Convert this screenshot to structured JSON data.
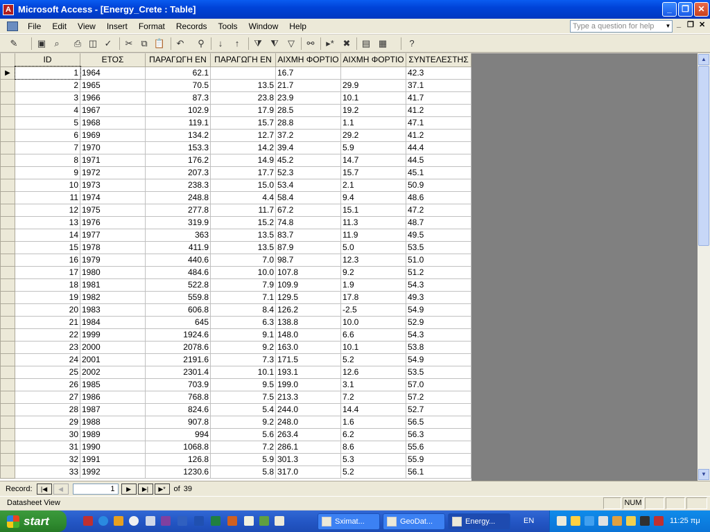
{
  "window": {
    "title": "Microsoft Access - [Energy_Crete : Table]",
    "buttons": {
      "minimize": "_",
      "restore": "❐",
      "close": "✕"
    }
  },
  "menu": {
    "items": [
      "File",
      "Edit",
      "View",
      "Insert",
      "Format",
      "Records",
      "Tools",
      "Window",
      "Help"
    ],
    "ask_placeholder": "Type a question for help"
  },
  "toolbar": {
    "icons": [
      "design-view-icon",
      "save-icon",
      "search-file-icon",
      "print-icon",
      "print-preview-icon",
      "spelling-icon",
      "cut-icon",
      "copy-icon",
      "paste-icon",
      "undo-icon",
      "hyperlink-icon",
      "sort-ascending-icon",
      "sort-descending-icon",
      "filter-by-selection-icon",
      "filter-by-form-icon",
      "apply-filter-icon",
      "find-icon",
      "new-record-icon",
      "delete-record-icon",
      "database-window-icon",
      "new-object-icon",
      "help-icon"
    ]
  },
  "table": {
    "columns": [
      "ID",
      "ΕΤΟΣ",
      "ΠΑΡΑΓΩΓΗ ΕΝ",
      "ΠΑΡΑΓΩΓΗ ΕΝ",
      "ΑΙΧΜΗ ΦΟΡΤΙΟ",
      "ΑΙΧΜΗ ΦΟΡΤΙΟ",
      "ΣΥΝΤΕΛΕΣΤΗΣ"
    ],
    "rows": [
      [
        "1",
        "1964",
        "62.1",
        "",
        "16.7",
        "",
        "42.3"
      ],
      [
        "2",
        "1965",
        "70.5",
        "13.5",
        "21.7",
        "29.9",
        "37.1"
      ],
      [
        "3",
        "1966",
        "87.3",
        "23.8",
        "23.9",
        "10.1",
        "41.7"
      ],
      [
        "4",
        "1967",
        "102.9",
        "17.9",
        "28.5",
        "19.2",
        "41.2"
      ],
      [
        "5",
        "1968",
        "119.1",
        "15.7",
        "28.8",
        "1.1",
        "47.1"
      ],
      [
        "6",
        "1969",
        "134.2",
        "12.7",
        "37.2",
        "29.2",
        "41.2"
      ],
      [
        "7",
        "1970",
        "153.3",
        "14.2",
        "39.4",
        "5.9",
        "44.4"
      ],
      [
        "8",
        "1971",
        "176.2",
        "14.9",
        "45.2",
        "14.7",
        "44.5"
      ],
      [
        "9",
        "1972",
        "207.3",
        "17.7",
        "52.3",
        "15.7",
        "45.1"
      ],
      [
        "10",
        "1973",
        "238.3",
        "15.0",
        "53.4",
        "2.1",
        "50.9"
      ],
      [
        "11",
        "1974",
        "248.8",
        "4.4",
        "58.4",
        "9.4",
        "48.6"
      ],
      [
        "12",
        "1975",
        "277.8",
        "11.7",
        "67.2",
        "15.1",
        "47.2"
      ],
      [
        "13",
        "1976",
        "319.9",
        "15.2",
        "74.8",
        "11.3",
        "48.7"
      ],
      [
        "14",
        "1977",
        "363",
        "13.5",
        "83.7",
        "11.9",
        "49.5"
      ],
      [
        "15",
        "1978",
        "411.9",
        "13.5",
        "87.9",
        "5.0",
        "53.5"
      ],
      [
        "16",
        "1979",
        "440.6",
        "7.0",
        "98.7",
        "12.3",
        "51.0"
      ],
      [
        "17",
        "1980",
        "484.6",
        "10.0",
        "107.8",
        "9.2",
        "51.2"
      ],
      [
        "18",
        "1981",
        "522.8",
        "7.9",
        "109.9",
        "1.9",
        "54.3"
      ],
      [
        "19",
        "1982",
        "559.8",
        "7.1",
        "129.5",
        "17.8",
        "49.3"
      ],
      [
        "20",
        "1983",
        "606.8",
        "8.4",
        "126.2",
        "-2.5",
        "54.9"
      ],
      [
        "21",
        "1984",
        "645",
        "6.3",
        "138.8",
        "10.0",
        "52.9"
      ],
      [
        "22",
        "1999",
        "1924.6",
        "9.1",
        "148.0",
        "6.6",
        "54.3"
      ],
      [
        "23",
        "2000",
        "2078.6",
        "9.2",
        "163.0",
        "10.1",
        "53.8"
      ],
      [
        "24",
        "2001",
        "2191.6",
        "7.3",
        "171.5",
        "5.2",
        "54.9"
      ],
      [
        "25",
        "2002",
        "2301.4",
        "10.1",
        "193.1",
        "12.6",
        "53.5"
      ],
      [
        "26",
        "1985",
        "703.9",
        "9.5",
        "199.0",
        "3.1",
        "57.0"
      ],
      [
        "27",
        "1986",
        "768.8",
        "7.5",
        "213.3",
        "7.2",
        "57.2"
      ],
      [
        "28",
        "1987",
        "824.6",
        "5.4",
        "244.0",
        "14.4",
        "52.7"
      ],
      [
        "29",
        "1988",
        "907.8",
        "9.2",
        "248.0",
        "1.6",
        "56.5"
      ],
      [
        "30",
        "1989",
        "994",
        "5.6",
        "263.4",
        "6.2",
        "56.3"
      ],
      [
        "31",
        "1990",
        "1068.8",
        "7.2",
        "286.1",
        "8.6",
        "55.6"
      ],
      [
        "32",
        "1991",
        "126.8",
        "5.9",
        "301.3",
        "5.3",
        "55.9"
      ],
      [
        "33",
        "1992",
        "1230.6",
        "5.8",
        "317.0",
        "5.2",
        "56.1"
      ]
    ]
  },
  "nav": {
    "record_label": "Record:",
    "current": "1",
    "of_label": "of",
    "total": "39"
  },
  "status": {
    "view": "Datasheet View",
    "num": "NUM"
  },
  "taskbar": {
    "start": "start",
    "tasks": [
      "Sximat...",
      "GeoDat...",
      "Energy..."
    ],
    "lang": "EN",
    "clock": "11:25 πμ"
  }
}
